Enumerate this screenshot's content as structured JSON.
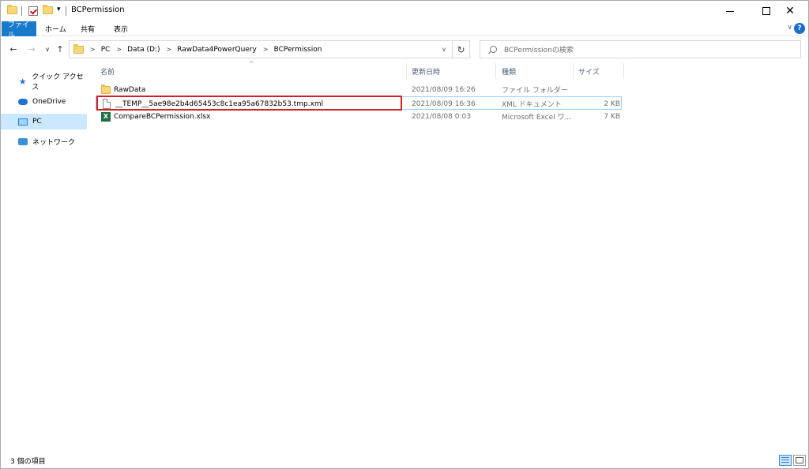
{
  "window": {
    "title": "BCPermission",
    "minimize_glyph": "",
    "close_glyph": "✕"
  },
  "ribbon": {
    "tabs": [
      "ファイル",
      "ホーム",
      "共有",
      "表示"
    ],
    "collapse_glyph": "∨",
    "help_glyph": "?"
  },
  "nav": {
    "back_glyph": "←",
    "forward_glyph": "→",
    "recent_glyph": "∨",
    "up_glyph": "↑",
    "refresh_glyph": "↻",
    "address_drop_glyph": "∨",
    "breadcrumb": [
      "PC",
      "Data (D:)",
      "RawData4PowerQuery",
      "BCPermission"
    ],
    "breadcrumb_sep": ">",
    "search_placeholder": "BCPermissionの検索"
  },
  "sidebar": {
    "items": [
      {
        "label": "クイック アクセス",
        "icon": "star-icon"
      },
      {
        "label": "OneDrive",
        "icon": "cloud-icon"
      },
      {
        "label": "PC",
        "icon": "monitor-icon"
      },
      {
        "label": "ネットワーク",
        "icon": "network-icon"
      }
    ],
    "selected": "PC"
  },
  "columns": {
    "name": "名前",
    "modified": "更新日時",
    "type": "種類",
    "size": "サイズ",
    "sort_glyph": "^"
  },
  "files": [
    {
      "name": "RawData",
      "modified": "2021/08/09 16:26",
      "type": "ファイル フォルダー",
      "size": "",
      "icon": "folder-icon"
    },
    {
      "name": "__TEMP__5ae98e2b4d65453c8c1ea95a67832b53.tmp.xml",
      "modified": "2021/08/09 16:36",
      "type": "XML ドキュメント",
      "size": "2 KB",
      "icon": "document-icon"
    },
    {
      "name": "CompareBCPermission.xlsx",
      "modified": "2021/08/08 0:03",
      "type": "Microsoft Excel ワ...",
      "size": "7 KB",
      "icon": "excel-icon"
    }
  ],
  "excel_letter": "X",
  "status": {
    "count_text": "3 個の項目"
  },
  "colors": {
    "accent": "#1979ca",
    "selection": "#cce8ff",
    "highlight_box": "#d1202a"
  }
}
